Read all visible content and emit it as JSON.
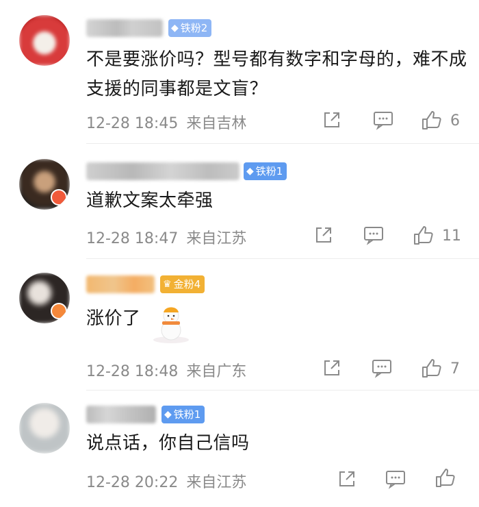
{
  "comments": [
    {
      "badge": "铁粉2",
      "badge_color": "#8eb6f5",
      "text": "不是要涨价吗？型号都有数字和字母的，难不成支援的同事都是文盲？",
      "date": "12-28 18:45",
      "location": "来自吉林",
      "likes": "6"
    },
    {
      "badge": "铁粉1",
      "badge_color": "#5e9bf0",
      "text": "道歉文案太牵强",
      "date": "12-28 18:47",
      "location": "来自江苏",
      "likes": "11"
    },
    {
      "badge": "金粉4",
      "badge_color": "#f2b134",
      "text": "涨价了",
      "date": "12-28 18:48",
      "location": "来自广东",
      "likes": "7"
    },
    {
      "badge": "铁粉1",
      "badge_color": "#5e9bf0",
      "text": "说点话，你自己信吗",
      "date": "12-28 20:22",
      "location": "来自江苏",
      "likes": ""
    }
  ]
}
